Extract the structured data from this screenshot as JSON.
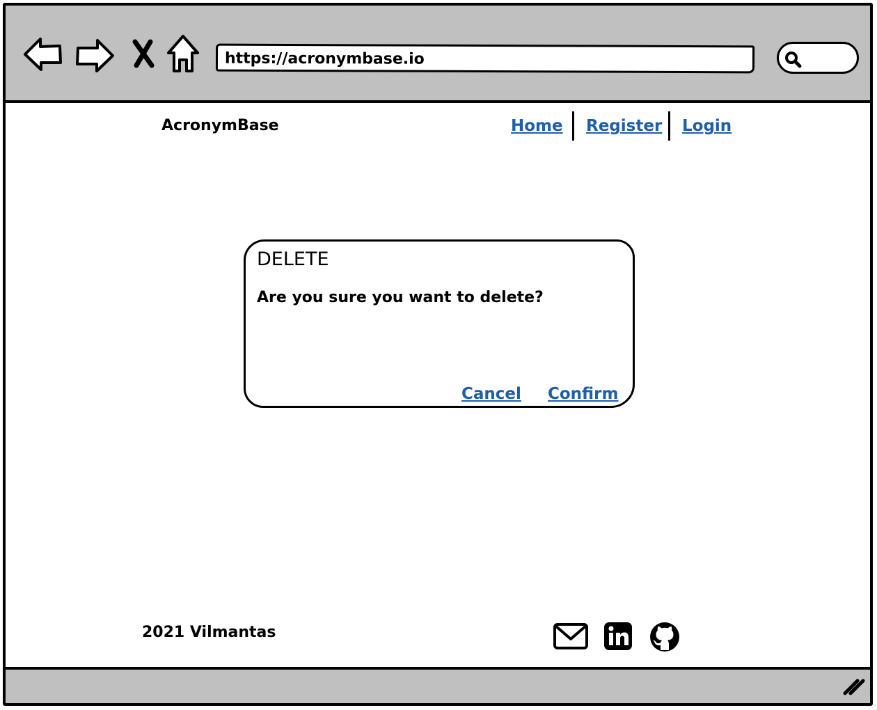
{
  "browser": {
    "url": "https://acronymbase.io",
    "icons": [
      "back-arrow-icon",
      "forward-arrow-icon",
      "close-x-icon",
      "home-icon",
      "search-icon",
      "resize-grip-icon"
    ]
  },
  "header": {
    "brand": "AcronymBase",
    "nav": {
      "home": "Home",
      "register": "Register",
      "login": "Login"
    },
    "link_color": "#1f5ea8"
  },
  "dialog": {
    "title": "DELETE",
    "message": "Are you sure you want to delete?",
    "cancel_label": "Cancel",
    "confirm_label": "Confirm"
  },
  "footer": {
    "copyright": "2021 Vilmantas",
    "social_icons": [
      "mail-icon",
      "linkedin-icon",
      "github-icon"
    ]
  },
  "colors": {
    "chrome": "#c0c0c0",
    "link": "#1f5ea8"
  }
}
